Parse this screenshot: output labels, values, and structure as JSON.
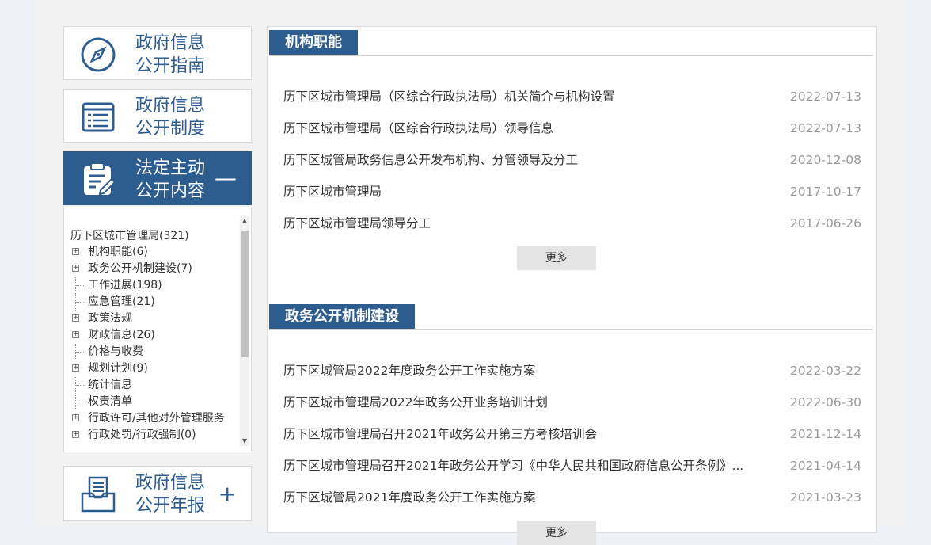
{
  "sidebar": {
    "guide": {
      "line1": "政府信息",
      "line2": "公开指南"
    },
    "system": {
      "line1": "政府信息",
      "line2": "公开制度"
    },
    "statutory": {
      "line1": "法定主动",
      "line2": "公开内容",
      "toggle": "—"
    },
    "annual": {
      "line1": "政府信息",
      "line2": "公开年报",
      "toggle": "+"
    },
    "tree": {
      "root": "历下区城市管理局(321)",
      "items": [
        {
          "label": "机构职能(6)",
          "expandable": true
        },
        {
          "label": "政务公开机制建设(7)",
          "expandable": true
        },
        {
          "label": "工作进展(198)",
          "expandable": false
        },
        {
          "label": "应急管理(21)",
          "expandable": false
        },
        {
          "label": "政策法规",
          "expandable": true
        },
        {
          "label": "财政信息(26)",
          "expandable": true
        },
        {
          "label": "价格与收费",
          "expandable": false
        },
        {
          "label": "规划计划(9)",
          "expandable": true
        },
        {
          "label": "统计信息",
          "expandable": false
        },
        {
          "label": "权责清单",
          "expandable": false
        },
        {
          "label": "行政许可/其他对外管理服务",
          "expandable": true
        },
        {
          "label": "行政处罚/行政强制(0)",
          "expandable": true
        }
      ]
    }
  },
  "sections": [
    {
      "title": "机构职能",
      "more": "更多",
      "rows": [
        {
          "title": "历下区城市管理局（区综合行政执法局）机关简介与机构设置",
          "date": "2022-07-13"
        },
        {
          "title": "历下区城市管理局（区综合行政执法局）领导信息",
          "date": "2022-07-13"
        },
        {
          "title": "历下区城管局政务信息公开发布机构、分管领导及分工",
          "date": "2020-12-08"
        },
        {
          "title": "历下区城市管理局",
          "date": "2017-10-17"
        },
        {
          "title": "历下区城市管理局领导分工",
          "date": "2017-06-26"
        }
      ]
    },
    {
      "title": "政务公开机制建设",
      "more": "更多",
      "rows": [
        {
          "title": "历下区城管局2022年度政务公开工作实施方案",
          "date": "2022-03-22"
        },
        {
          "title": "历下区城市管理局2022年政务公开业务培训计划",
          "date": "2022-06-30"
        },
        {
          "title": "历下区城市管理局召开2021年政务公开第三方考核培训会",
          "date": "2021-12-14"
        },
        {
          "title": "历下区城市管理局召开2021年政务公开学习《中华人民共和国政府信息公开条例》...",
          "date": "2021-04-14"
        },
        {
          "title": "历下区城管局2021年度政务公开工作实施方案",
          "date": "2021-03-23"
        }
      ]
    }
  ]
}
